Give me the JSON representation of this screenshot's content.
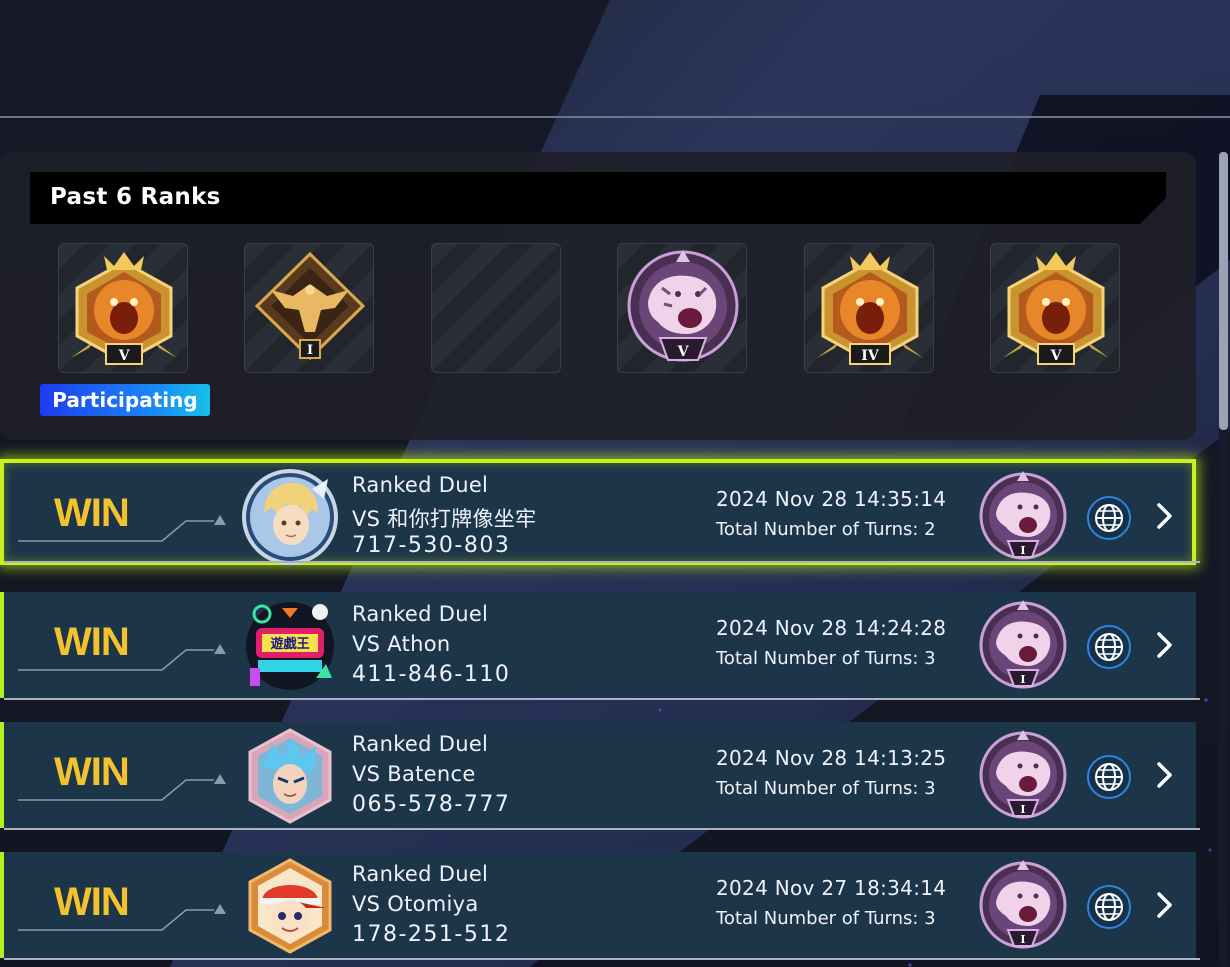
{
  "ranks_panel": {
    "title": "Past 6 Ranks",
    "participating_label": "Participating",
    "ranks": [
      {
        "tier": "lion",
        "level": "V",
        "accent": "#e08a2a"
      },
      {
        "tier": "eagle",
        "level": "I",
        "accent": "#c89a3a"
      },
      {
        "tier": "empty",
        "level": "",
        "accent": "#2a2e36"
      },
      {
        "tier": "tiger",
        "level": "V",
        "accent": "#c08ad8"
      },
      {
        "tier": "lion",
        "level": "IV",
        "accent": "#e08a2a"
      },
      {
        "tier": "lion",
        "level": "V",
        "accent": "#e08a2a"
      }
    ]
  },
  "duels": [
    {
      "result": "WIN",
      "type": "Ranked Duel",
      "opponent": "VS 和你打牌像坐牢",
      "player_id": "717-530-803",
      "datetime": "2024 Nov 28 14:35:14",
      "turns_label": "Total Number of Turns: 2",
      "rank_level": "I",
      "selected": true,
      "avatar_icon": "blonde-hero-avatar-icon"
    },
    {
      "result": "WIN",
      "type": "Ranked Duel",
      "opponent": "VS Athon",
      "player_id": "411-846-110",
      "datetime": "2024 Nov 28 14:24:28",
      "turns_label": "Total Number of Turns: 3",
      "rank_level": "I",
      "selected": false,
      "avatar_icon": "neon-logo-avatar-icon"
    },
    {
      "result": "WIN",
      "type": "Ranked Duel",
      "opponent": "VS Batence",
      "player_id": "065-578-777",
      "datetime": "2024 Nov 28 14:13:25",
      "turns_label": "Total Number of Turns: 3",
      "rank_level": "I",
      "selected": false,
      "avatar_icon": "blue-hair-avatar-icon"
    },
    {
      "result": "WIN",
      "type": "Ranked Duel",
      "opponent": "VS Otomiya",
      "player_id": "178-251-512",
      "datetime": "2024 Nov 27 18:34:14",
      "turns_label": "Total Number of Turns: 3",
      "rank_level": "I",
      "selected": false,
      "avatar_icon": "cap-kid-avatar-icon"
    }
  ],
  "colors": {
    "win": "#f3c22e",
    "row_bg": "#1d3549",
    "highlight": "#c7f21b",
    "participating": "#1e6af2"
  }
}
